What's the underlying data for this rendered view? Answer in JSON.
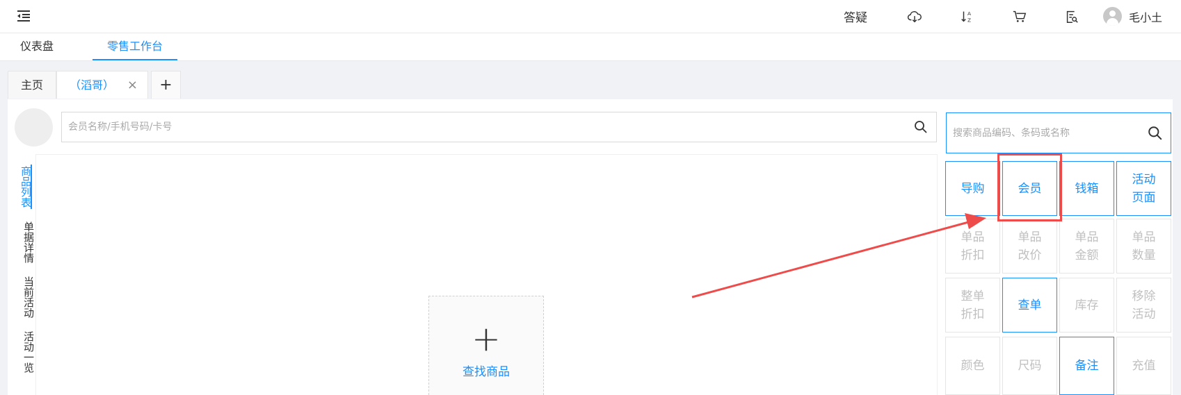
{
  "header": {
    "qa_label": "答疑",
    "icons": [
      "menu-fold-icon",
      "cloud-download-icon",
      "sort-az-icon",
      "cart-icon",
      "document-search-icon"
    ],
    "user_name": "毛小土"
  },
  "nav": {
    "tabs": [
      {
        "label": "仪表盘",
        "active": false
      },
      {
        "label": "零售工作台",
        "active": true
      }
    ]
  },
  "page_tabs": {
    "home": "主页",
    "current": "（滔哥）",
    "close": "×",
    "add": "+"
  },
  "member_search": {
    "placeholder": "会员名称/手机号码/卡号",
    "value": ""
  },
  "goods_search": {
    "placeholder": "搜索商品编码、条码或名称",
    "value": ""
  },
  "side_tabs": [
    {
      "label": "商品列表",
      "active": true
    },
    {
      "label": "单据详情",
      "active": false
    },
    {
      "label": "当前活动",
      "active": false
    },
    {
      "label": "活动一览",
      "active": false
    }
  ],
  "goods_area": {
    "add_symbol": "+",
    "find_label": "查找商品"
  },
  "function_buttons": [
    {
      "label": "导购",
      "enabled": true
    },
    {
      "label": "会员",
      "enabled": true
    },
    {
      "label": "钱箱",
      "enabled": true
    },
    {
      "label": "活动\n页面",
      "enabled": true
    },
    {
      "label": "单品\n折扣",
      "enabled": false
    },
    {
      "label": "单品\n改价",
      "enabled": false
    },
    {
      "label": "单品\n金额",
      "enabled": false
    },
    {
      "label": "单品\n数量",
      "enabled": false
    },
    {
      "label": "整单\n折扣",
      "enabled": false
    },
    {
      "label": "查单",
      "enabled": true
    },
    {
      "label": "库存",
      "enabled": false
    },
    {
      "label": "移除\n活动",
      "enabled": false
    },
    {
      "label": "颜色",
      "enabled": false
    },
    {
      "label": "尺码",
      "enabled": false
    },
    {
      "label": "备注",
      "enabled": true
    },
    {
      "label": "充值",
      "enabled": false
    }
  ],
  "colors": {
    "accent": "#1890ff",
    "annotation": "#ee4b4b",
    "disabled_text": "#c0c0c0"
  }
}
